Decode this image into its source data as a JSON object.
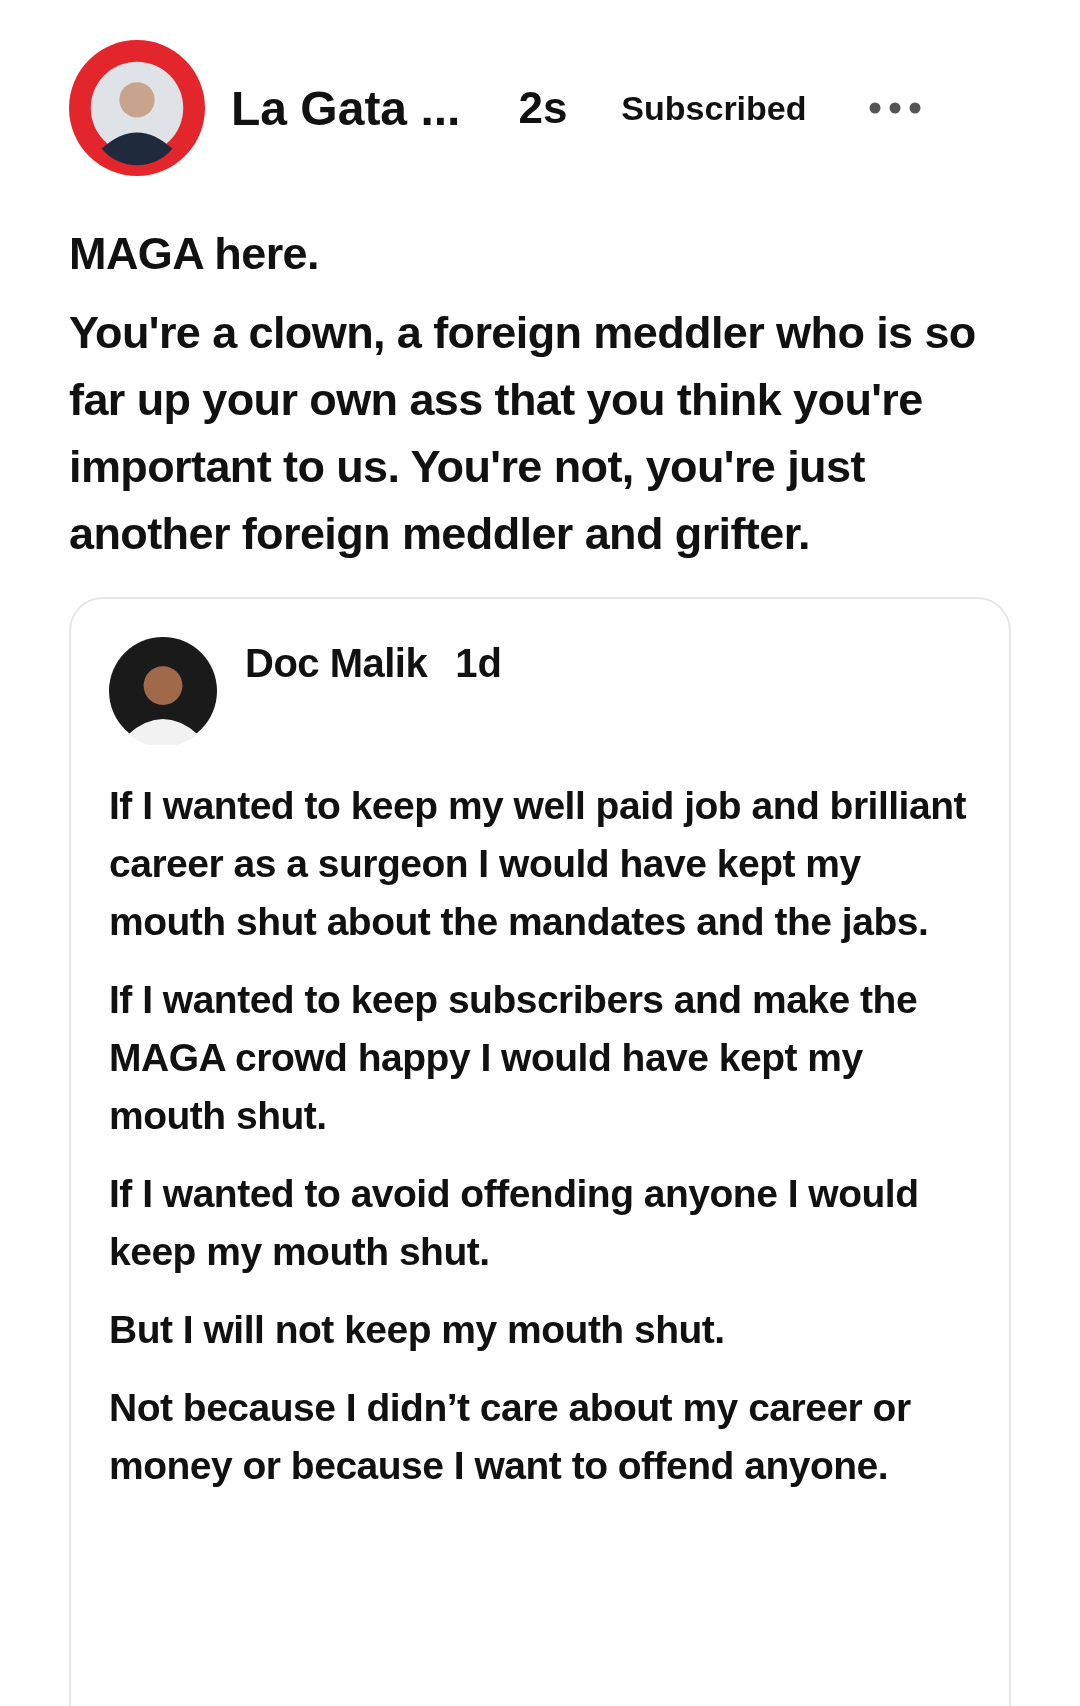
{
  "post": {
    "author": "La Gata ...",
    "time": "2s",
    "subscription": "Subscribed",
    "paragraphs": [
      "MAGA here.",
      "You're a clown, a foreign meddler who is so far up your own ass that you think you're important to us. You're not, you're just another foreign meddler and grifter."
    ]
  },
  "quoted_post": {
    "author": "Doc Malik",
    "time": "1d",
    "paragraphs": [
      "If I wanted to keep my well paid job and brilliant career as a surgeon I would have kept my mouth shut about the mandates and the jabs.",
      "If I wanted to keep subscribers and make the MAGA crowd happy I would have kept my mouth shut.",
      "If I wanted to avoid offending anyone I would keep my mouth shut.",
      "But I will not keep my mouth shut.",
      "Not because I didn’t care about my career or money or because I want to offend anyone."
    ]
  }
}
